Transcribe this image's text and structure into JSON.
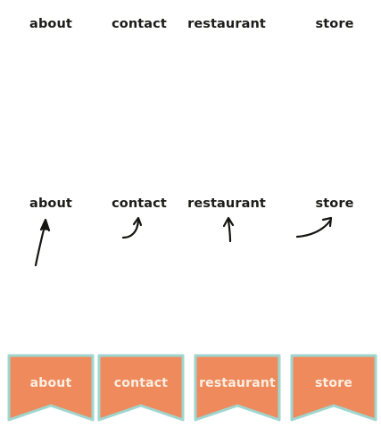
{
  "nav_top": {
    "items": [
      {
        "label": "about"
      },
      {
        "label": "contact"
      },
      {
        "label": "restaurant"
      },
      {
        "label": "store"
      }
    ]
  },
  "nav_arrows": {
    "items": [
      {
        "label": "about"
      },
      {
        "label": "contact"
      },
      {
        "label": "restaurant"
      },
      {
        "label": "store"
      }
    ]
  },
  "banners": {
    "items": [
      {
        "label": "about"
      },
      {
        "label": "contact"
      },
      {
        "label": "restaurant"
      },
      {
        "label": "store"
      }
    ],
    "fill_color": "#ef8a5c",
    "border_color": "#9fd6cf"
  },
  "icons": {
    "arrow_about": "hand-drawn-arrow-icon",
    "arrow_contact": "hand-drawn-curved-arrow-icon",
    "arrow_restaurant": "hand-drawn-up-arrow-icon",
    "arrow_store": "hand-drawn-curved-arrow-icon"
  }
}
